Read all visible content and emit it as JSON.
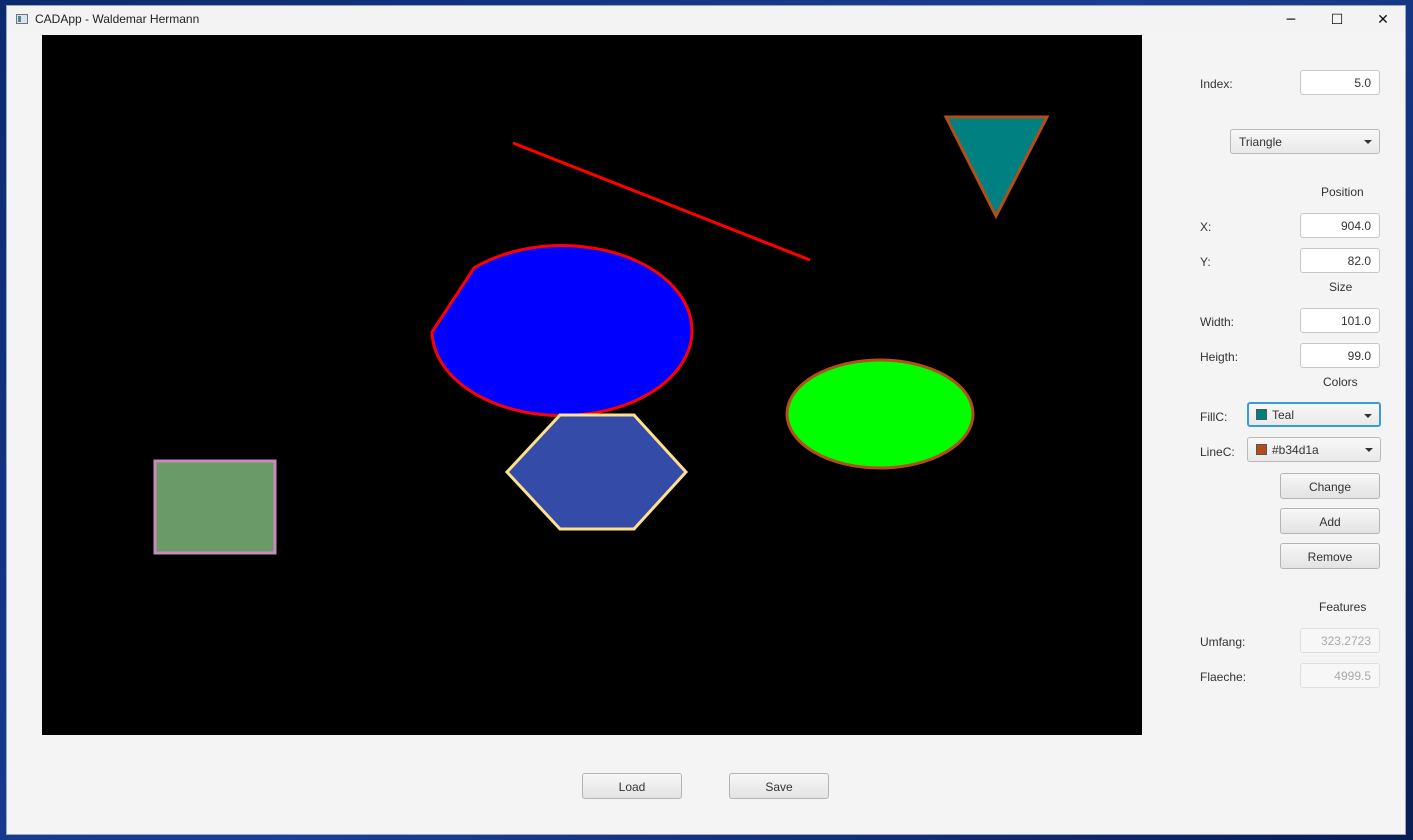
{
  "window": {
    "title": "CADApp - Waldemar Hermann",
    "minimize_glyph": "─",
    "maximize_glyph": "☐",
    "close_glyph": "✕"
  },
  "canvas": {
    "background": "#000000",
    "shapes": [
      {
        "kind": "ellipse-arc",
        "fill": "#0000ff",
        "stroke": "#ff0000"
      },
      {
        "kind": "line",
        "stroke": "#ff0000"
      },
      {
        "kind": "triangle",
        "fill": "#008080",
        "stroke": "#b34d1a"
      },
      {
        "kind": "ellipse",
        "fill": "#00ff00",
        "stroke": "#b34d1a"
      },
      {
        "kind": "hexagon",
        "fill": "#344ba8",
        "stroke": "#ffe08c"
      },
      {
        "kind": "rectangle",
        "fill": "#6a9a68",
        "stroke": "#c88ab8"
      }
    ]
  },
  "panel": {
    "index_label": "Index:",
    "index_value": "5.0",
    "shape_type": "Triangle",
    "position_header": "Position",
    "x_label": "X:",
    "x_value": "904.0",
    "y_label": "Y:",
    "y_value": "82.0",
    "size_header": "Size",
    "width_label": "Width:",
    "width_value": "101.0",
    "height_label": "Heigth:",
    "height_value": "99.0",
    "colors_header": "Colors",
    "fill_label": "FillC:",
    "fill_value": "Teal",
    "fill_color": "#008080",
    "line_label": "LineC:",
    "line_value": "#b34d1a",
    "line_color": "#b34d1a",
    "change_button": "Change",
    "add_button": "Add",
    "remove_button": "Remove",
    "features_header": "Features",
    "umfang_label": "Umfang:",
    "umfang_value": "323.2723",
    "flaeche_label": "Flaeche:",
    "flaeche_value": "4999.5"
  },
  "footer": {
    "load_button": "Load",
    "save_button": "Save"
  }
}
